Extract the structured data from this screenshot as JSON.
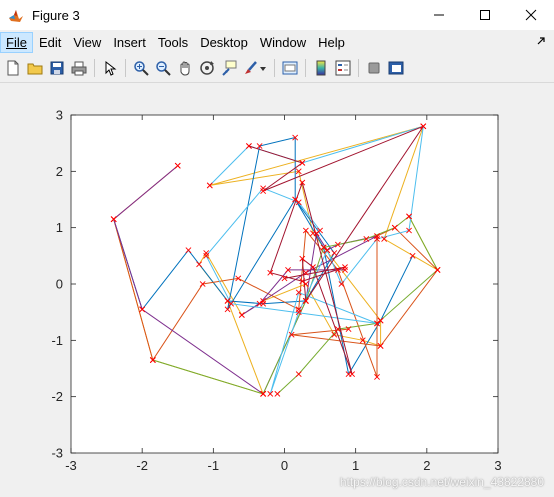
{
  "window": {
    "title": "Figure 3",
    "controls": {
      "minimize": "—",
      "maximize": "☐",
      "close": "✕"
    }
  },
  "menu": {
    "items": [
      {
        "id": "file",
        "label": "File"
      },
      {
        "id": "edit",
        "label": "Edit"
      },
      {
        "id": "view",
        "label": "View"
      },
      {
        "id": "insert",
        "label": "Insert"
      },
      {
        "id": "tools",
        "label": "Tools"
      },
      {
        "id": "desktop",
        "label": "Desktop"
      },
      {
        "id": "window",
        "label": "Window"
      },
      {
        "id": "help",
        "label": "Help"
      }
    ]
  },
  "toolbar": {
    "icons": [
      "new-figure-icon",
      "open-file-icon",
      "save-icon",
      "print-icon",
      "pointer-icon",
      "zoom-in-icon",
      "zoom-out-icon",
      "pan-icon",
      "rotate-3d-icon",
      "data-cursor-icon",
      "brush-icon",
      "link-plot-icon",
      "colorbar-icon",
      "legend-icon",
      "hide-plot-tools-icon",
      "show-plot-tools-icon"
    ]
  },
  "watermark": "https://blog.csdn.net/weixin_43822880",
  "colors": {
    "series": [
      "#0072BD",
      "#D95319",
      "#EDB120",
      "#7E2F8E",
      "#77AC30",
      "#4DBEEE",
      "#A2142F"
    ],
    "marker": "#ff0000",
    "axes_bg": "#ffffff",
    "figure_bg": "#f0f0f0"
  },
  "chart_data": {
    "type": "line",
    "title": "",
    "xlabel": "",
    "ylabel": "",
    "xlim": [
      -3,
      3
    ],
    "ylim": [
      -3,
      3
    ],
    "xticks": [
      "-3",
      "-2",
      "-1",
      "0",
      "1",
      "2",
      "3"
    ],
    "yticks": [
      "-3",
      "-2",
      "-1",
      "0",
      "1",
      "2",
      "3"
    ],
    "grid": false,
    "marker": "x",
    "series": [
      {
        "color": "#EDB120",
        "points": [
          [
            -2.4,
            1.15
          ],
          [
            -1.85,
            -1.35
          ],
          [
            -0.3,
            -1.95
          ],
          [
            -0.8,
            -0.3
          ],
          [
            -1.2,
            0.35
          ],
          [
            -1.1,
            0.55
          ],
          [
            -0.6,
            -0.55
          ],
          [
            -0.3,
            -0.3
          ],
          [
            0.3,
            0.0
          ],
          [
            0.7,
            -0.9
          ],
          [
            1.1,
            -1.0
          ],
          [
            1.35,
            -1.1
          ],
          [
            1.35,
            -0.65
          ],
          [
            0.4,
            0.9
          ],
          [
            0.2,
            2.0
          ],
          [
            -1.05,
            1.75
          ],
          [
            1.95,
            2.8
          ],
          [
            1.4,
            0.8
          ],
          [
            2.15,
            0.25
          ],
          [
            1.75,
            1.2
          ]
        ]
      },
      {
        "color": "#0072BD",
        "points": [
          [
            -2.4,
            1.15
          ],
          [
            -2.0,
            -0.45
          ],
          [
            -1.35,
            0.6
          ],
          [
            -0.8,
            -0.3
          ],
          [
            -0.3,
            -0.35
          ],
          [
            0.3,
            -0.3
          ],
          [
            0.7,
            0.55
          ],
          [
            0.15,
            1.5
          ],
          [
            -0.8,
            -0.45
          ],
          [
            -0.35,
            2.45
          ],
          [
            0.15,
            2.6
          ],
          [
            0.15,
            1.5
          ],
          [
            0.55,
            0.65
          ],
          [
            0.9,
            -1.6
          ],
          [
            1.35,
            -0.65
          ],
          [
            1.8,
            0.5
          ]
        ]
      },
      {
        "color": "#D95319",
        "points": [
          [
            -1.5,
            2.1
          ],
          [
            -2.4,
            1.15
          ],
          [
            -1.85,
            -1.35
          ],
          [
            -1.15,
            0.0
          ],
          [
            -0.65,
            0.1
          ],
          [
            0.2,
            -0.45
          ],
          [
            0.3,
            0.95
          ],
          [
            0.75,
            0.25
          ],
          [
            1.3,
            -1.65
          ],
          [
            1.3,
            0.85
          ],
          [
            1.55,
            1.0
          ],
          [
            2.15,
            0.25
          ],
          [
            1.35,
            -1.1
          ],
          [
            0.1,
            -0.9
          ],
          [
            0.9,
            -0.8
          ]
        ]
      },
      {
        "color": "#7E2F8E",
        "points": [
          [
            -1.5,
            2.1
          ],
          [
            -2.4,
            1.15
          ],
          [
            -2.0,
            -0.45
          ],
          [
            -0.3,
            -1.95
          ],
          [
            0.3,
            -0.3
          ],
          [
            0.45,
            0.9
          ],
          [
            0.6,
            0.6
          ],
          [
            0.75,
            0.7
          ],
          [
            1.3,
            0.85
          ],
          [
            0.3,
            0.2
          ],
          [
            -0.6,
            -0.55
          ],
          [
            -0.35,
            -0.35
          ],
          [
            0.05,
            0.25
          ],
          [
            0.85,
            0.25
          ]
        ]
      },
      {
        "color": "#77AC30",
        "points": [
          [
            -1.85,
            -1.35
          ],
          [
            -0.3,
            -1.95
          ],
          [
            0.3,
            -0.3
          ],
          [
            0.55,
            0.65
          ],
          [
            1.15,
            0.8
          ],
          [
            1.55,
            1.0
          ],
          [
            1.75,
            1.2
          ],
          [
            2.15,
            0.25
          ],
          [
            1.3,
            -0.7
          ],
          [
            0.75,
            -0.8
          ],
          [
            0.2,
            -1.6
          ],
          [
            -0.1,
            -1.95
          ]
        ]
      },
      {
        "color": "#4DBEEE",
        "points": [
          [
            -1.05,
            1.75
          ],
          [
            -0.5,
            2.45
          ],
          [
            0.25,
            2.15
          ],
          [
            1.95,
            2.8
          ],
          [
            1.75,
            0.95
          ],
          [
            1.3,
            0.8
          ],
          [
            0.8,
            0.0
          ],
          [
            0.6,
            0.6
          ],
          [
            0.2,
            -0.5
          ],
          [
            -0.2,
            -1.95
          ],
          [
            0.2,
            -0.15
          ],
          [
            1.3,
            -0.7
          ],
          [
            -0.75,
            -0.35
          ],
          [
            -1.1,
            0.5
          ],
          [
            -0.3,
            1.7
          ],
          [
            0.2,
            1.45
          ],
          [
            0.5,
            0.95
          ]
        ]
      },
      {
        "color": "#A2142F",
        "points": [
          [
            -0.5,
            2.45
          ],
          [
            0.25,
            2.15
          ],
          [
            -0.3,
            1.65
          ],
          [
            1.95,
            2.8
          ],
          [
            0.3,
            -0.3
          ],
          [
            0.25,
            0.45
          ],
          [
            0.4,
            0.3
          ],
          [
            0.95,
            -1.6
          ],
          [
            0.25,
            1.8
          ],
          [
            -0.2,
            0.2
          ],
          [
            0.25,
            0.05
          ],
          [
            0.85,
            0.3
          ],
          [
            0.0,
            0.1
          ]
        ]
      }
    ]
  }
}
